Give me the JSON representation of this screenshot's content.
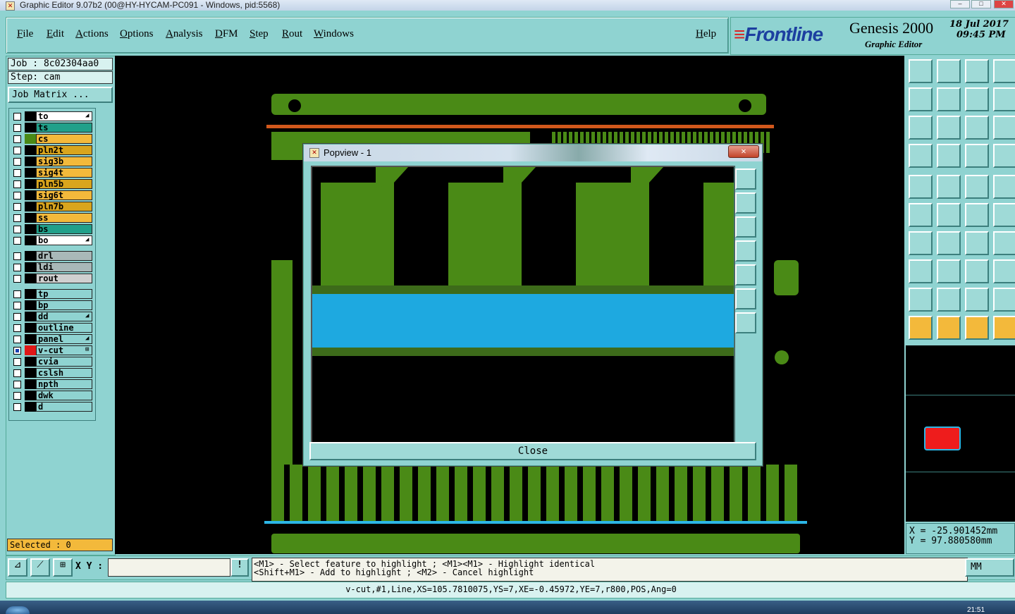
{
  "window": {
    "title": "Graphic Editor 9.07b2 (00@HY-HYCAM-PC091 - Windows, pid:5568)"
  },
  "menu": {
    "items": [
      "File",
      "Edit",
      "Actions",
      "Options",
      "Analysis",
      "DFM",
      "Step",
      "Rout",
      "Windows"
    ],
    "help": "Help"
  },
  "brand": {
    "logo": "Frontline",
    "product": "Genesis 2000",
    "subtitle": "Graphic Editor",
    "date": "18 Jul 2017",
    "time": "09:45 PM"
  },
  "job": {
    "job_label": "Job : 8c02304aa0",
    "step_label": "Step: cam",
    "matrix_button": "Job Matrix ..."
  },
  "layers": [
    {
      "name": "to",
      "color": "#ffffff",
      "mark": "◢"
    },
    {
      "name": "ts",
      "color": "#21a08a"
    },
    {
      "name": "cs",
      "color": "#f3b93b",
      "swatch": "#4a8a16"
    },
    {
      "name": "pln2t",
      "color": "#d9a51d"
    },
    {
      "name": "sig3b",
      "color": "#f3b93b"
    },
    {
      "name": "sig4t",
      "color": "#f3b93b"
    },
    {
      "name": "pln5b",
      "color": "#d9a51d"
    },
    {
      "name": "sig6t",
      "color": "#f3b93b"
    },
    {
      "name": "pln7b",
      "color": "#d9a51d"
    },
    {
      "name": "ss",
      "color": "#f3b93b"
    },
    {
      "name": "bs",
      "color": "#21a08a"
    },
    {
      "name": "bo",
      "color": "#ffffff",
      "mark": "◢"
    },
    {
      "name": "drl",
      "color": "#a9b8b8"
    },
    {
      "name": "ldi",
      "color": "#a9b8b8"
    },
    {
      "name": "rout",
      "color": "#d0d0d0"
    },
    {
      "name": "tp",
      "color": "#8fd3d1"
    },
    {
      "name": "bp",
      "color": "#8fd3d1"
    },
    {
      "name": "dd",
      "color": "#8fd3d1",
      "mark": "◢"
    },
    {
      "name": "outline",
      "color": "#8fd3d1"
    },
    {
      "name": "panel",
      "color": "#8fd3d1",
      "mark": "◢"
    },
    {
      "name": "v-cut",
      "color": "#8fd3d1",
      "swatch": "#e01818",
      "mark": "⊞",
      "checked": true
    },
    {
      "name": "cvia",
      "color": "#8fd3d1"
    },
    {
      "name": "cslsh",
      "color": "#8fd3d1"
    },
    {
      "name": "npth",
      "color": "#8fd3d1"
    },
    {
      "name": "dwk",
      "color": "#8fd3d1"
    },
    {
      "name": "d",
      "color": "#8fd3d1"
    }
  ],
  "popview": {
    "title": "Popview - 1",
    "close_x": "✕",
    "close_button": "Close"
  },
  "selected": "Selected : 0",
  "xy": {
    "label": "X Y :",
    "value": ""
  },
  "hints": {
    "line1": "<M1> - Select feature to highlight ; <M1><M1> - Highlight identical",
    "line2": "<Shift+M1> - Add to highlight ; <M2> - Cancel highlight"
  },
  "units": "MM",
  "coords": {
    "x": "X = -25.901452mm",
    "y": "Y = 97.880580mm"
  },
  "status": "v-cut,#1,Line,XS=105.7810075,YS=7,XE=-0.45972,YE=7,r800,POS,Ang=0",
  "taskbar": {
    "time": "21:51"
  }
}
